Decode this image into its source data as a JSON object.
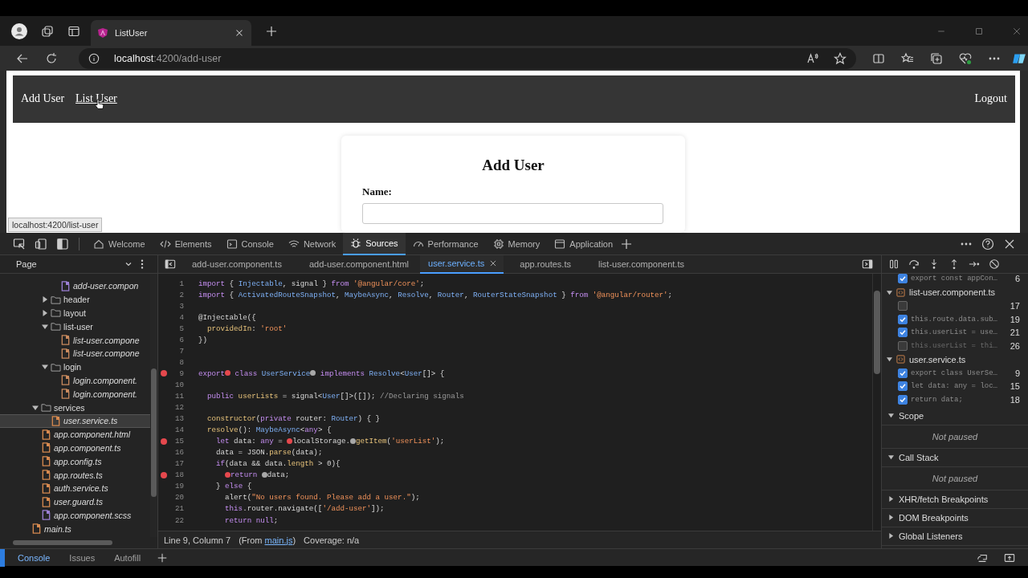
{
  "browser": {
    "tab": {
      "title": "ListUser"
    },
    "address": {
      "host": "localhost",
      "path": ":4200/add-user"
    }
  },
  "page": {
    "nav": {
      "links": [
        {
          "label": "Add User",
          "hovered": false
        },
        {
          "label": "List User",
          "hovered": true
        }
      ],
      "logout": "Logout"
    },
    "card": {
      "title": "Add User",
      "field_label": "Name:"
    },
    "status_url": "localhost:4200/list-user"
  },
  "devtools": {
    "tabs": [
      {
        "label": "Welcome",
        "selected": false
      },
      {
        "label": "Elements",
        "selected": false
      },
      {
        "label": "Console",
        "selected": false
      },
      {
        "label": "Network",
        "selected": false
      },
      {
        "label": "Sources",
        "selected": true
      },
      {
        "label": "Performance",
        "selected": false
      },
      {
        "label": "Memory",
        "selected": false
      },
      {
        "label": "Application",
        "selected": false
      }
    ],
    "sidebar": {
      "header": "Page",
      "tree": [
        {
          "children": [
            {
              "children": [
                {
                  "children": [
                    {
                      "name": "add-user.compon",
                      "kind": "file",
                      "selected": false,
                      "color": "#9b7fd4"
                    }
                  ]
                },
                {
                  "name": "header",
                  "kind": "folder",
                  "expanded": false
                },
                {
                  "name": "layout",
                  "kind": "folder",
                  "expanded": false
                },
                {
                  "name": "list-user",
                  "kind": "folder",
                  "expanded": true,
                  "children": [
                    {
                      "name": "list-user.compone",
                      "kind": "file",
                      "selected": false,
                      "color": "#c98a5e"
                    },
                    {
                      "name": "list-user.compone",
                      "kind": "file",
                      "selected": false,
                      "color": "#c98a5e"
                    }
                  ]
                },
                {
                  "name": "login",
                  "kind": "folder",
                  "expanded": true,
                  "children": [
                    {
                      "name": "login.component.",
                      "kind": "file",
                      "selected": false,
                      "color": "#c98a5e"
                    },
                    {
                      "name": "login.component.",
                      "kind": "file",
                      "selected": false,
                      "color": "#c98a5e"
                    }
                  ]
                }
              ]
            },
            {
              "name": "services",
              "kind": "folder",
              "expanded": true,
              "children": [
                {
                  "name": "user.service.ts",
                  "kind": "file",
                  "selected": true,
                  "color": "#d6894f"
                }
              ]
            },
            {
              "name": "app.component.html",
              "kind": "file",
              "selected": false,
              "color": "#d6894f"
            },
            {
              "name": "app.component.ts",
              "kind": "file",
              "selected": false,
              "color": "#d6894f"
            },
            {
              "name": "app.config.ts",
              "kind": "file",
              "selected": false,
              "color": "#d6894f"
            },
            {
              "name": "app.routes.ts",
              "kind": "file",
              "selected": false,
              "color": "#d6894f"
            },
            {
              "name": "auth.service.ts",
              "kind": "file",
              "selected": false,
              "color": "#d6894f"
            },
            {
              "name": "user.guard.ts",
              "kind": "file",
              "selected": false,
              "color": "#d6894f"
            },
            {
              "name": "app.component.scss",
              "kind": "file",
              "selected": false,
              "color": "#9b7fd4"
            }
          ]
        },
        {
          "name": "main.ts",
          "kind": "file",
          "selected": false,
          "color": "#d6894f"
        }
      ]
    },
    "files": [
      {
        "name": "add-user.component.ts",
        "selected": false
      },
      {
        "name": "add-user.component.html",
        "selected": false
      },
      {
        "name": "user.service.ts",
        "selected": true
      },
      {
        "name": "app.routes.ts",
        "selected": false
      },
      {
        "name": "list-user.component.ts",
        "selected": false
      }
    ],
    "lines": [
      {
        "number": "1",
        "breakpoint": false,
        "tokens": [
          {
            "kind": "keyword",
            "text": "import"
          },
          {
            "kind": "plain",
            "text": " { "
          },
          {
            "kind": "type",
            "text": "Injectable"
          },
          {
            "kind": "plain",
            "text": ", signal } "
          },
          {
            "kind": "keyword",
            "text": "from"
          },
          {
            "kind": "string",
            "text": " '@angular/core'"
          },
          {
            "kind": "plain",
            "text": ";"
          }
        ]
      },
      {
        "number": "2",
        "breakpoint": false,
        "tokens": [
          {
            "kind": "keyword",
            "text": "import"
          },
          {
            "kind": "plain",
            "text": " { "
          },
          {
            "kind": "type",
            "text": "ActivatedRouteSnapshot"
          },
          {
            "kind": "plain",
            "text": ", "
          },
          {
            "kind": "type",
            "text": "MaybeAsync"
          },
          {
            "kind": "plain",
            "text": ", "
          },
          {
            "kind": "type",
            "text": "Resolve"
          },
          {
            "kind": "plain",
            "text": ", "
          },
          {
            "kind": "type",
            "text": "Router"
          },
          {
            "kind": "plain",
            "text": ", "
          },
          {
            "kind": "type",
            "text": "RouterStateSnapshot"
          },
          {
            "kind": "plain",
            "text": " } "
          },
          {
            "kind": "keyword",
            "text": "from"
          },
          {
            "kind": "string",
            "text": " '@angular/router'"
          },
          {
            "kind": "plain",
            "text": ";"
          }
        ]
      },
      {
        "number": "3",
        "breakpoint": false
      },
      {
        "number": "4",
        "breakpoint": false,
        "tokens": [
          {
            "kind": "plain",
            "text": "@Injectable({"
          }
        ]
      },
      {
        "number": "5",
        "breakpoint": false,
        "tokens": [
          {
            "kind": "function",
            "text": "  providedIn"
          },
          {
            "kind": "plain",
            "text": ": "
          },
          {
            "kind": "string",
            "text": "'root'"
          }
        ]
      },
      {
        "number": "6",
        "breakpoint": false,
        "tokens": [
          {
            "kind": "plain",
            "text": "})"
          }
        ]
      },
      {
        "number": "7",
        "breakpoint": false
      },
      {
        "number": "8",
        "breakpoint": false
      },
      {
        "number": "9",
        "breakpoint": true,
        "tokens": [
          {
            "kind": "keyword",
            "text": "export",
            "dot_after": {
              "active": true
            }
          },
          {
            "kind": "keyword",
            "text": " class "
          },
          {
            "kind": "type",
            "text": "UserService",
            "dot_after": {
              "active": false
            }
          },
          {
            "kind": "keyword",
            "text": " implements "
          },
          {
            "kind": "type",
            "text": "Resolve"
          },
          {
            "kind": "plain",
            "text": "<"
          },
          {
            "kind": "type",
            "text": "User"
          },
          {
            "kind": "plain",
            "text": "[]> {"
          }
        ]
      },
      {
        "number": "10",
        "breakpoint": false
      },
      {
        "number": "11",
        "breakpoint": false,
        "tokens": [
          {
            "kind": "keyword",
            "text": "  public"
          },
          {
            "kind": "function",
            "text": " userLists"
          },
          {
            "kind": "plain",
            "text": " = signal<"
          },
          {
            "kind": "type",
            "text": "User"
          },
          {
            "kind": "plain",
            "text": "[]>([]); "
          },
          {
            "kind": "comment",
            "text": "//Declaring signals"
          }
        ]
      },
      {
        "number": "12",
        "breakpoint": false
      },
      {
        "number": "13",
        "breakpoint": false,
        "tokens": [
          {
            "kind": "function",
            "text": "  constructor"
          },
          {
            "kind": "plain",
            "text": "("
          },
          {
            "kind": "keyword",
            "text": "private"
          },
          {
            "kind": "plain",
            "text": " router: "
          },
          {
            "kind": "type",
            "text": "Router"
          },
          {
            "kind": "plain",
            "text": ") { }"
          }
        ]
      },
      {
        "number": "14",
        "breakpoint": false,
        "tokens": [
          {
            "kind": "function",
            "text": "  resolve"
          },
          {
            "kind": "plain",
            "text": "(): "
          },
          {
            "kind": "type",
            "text": "MaybeAsync"
          },
          {
            "kind": "plain",
            "text": "<"
          },
          {
            "kind": "keyword",
            "text": "any"
          },
          {
            "kind": "plain",
            "text": "> {"
          }
        ]
      },
      {
        "number": "15",
        "breakpoint": true,
        "tokens": [
          {
            "kind": "keyword",
            "text": "    let"
          },
          {
            "kind": "plain",
            "text": " data: "
          },
          {
            "kind": "keyword",
            "text": "any"
          },
          {
            "kind": "plain",
            "text": " = "
          },
          {
            "kind": "plain",
            "text": "localStorage.",
            "dot_before": {
              "active": true
            }
          },
          {
            "kind": "function",
            "text": "getItem",
            "dot_before": {
              "active": false
            }
          },
          {
            "kind": "plain",
            "text": "("
          },
          {
            "kind": "string",
            "text": "'userList'"
          },
          {
            "kind": "plain",
            "text": ");"
          }
        ]
      },
      {
        "number": "16",
        "breakpoint": false,
        "tokens": [
          {
            "kind": "plain",
            "text": "    data = JSON."
          },
          {
            "kind": "function",
            "text": "parse"
          },
          {
            "kind": "plain",
            "text": "(data);"
          }
        ]
      },
      {
        "number": "17",
        "breakpoint": false,
        "tokens": [
          {
            "kind": "keyword",
            "text": "    if"
          },
          {
            "kind": "plain",
            "text": "(data && data."
          },
          {
            "kind": "function",
            "text": "length"
          },
          {
            "kind": "plain",
            "text": " > 0){"
          }
        ]
      },
      {
        "number": "18",
        "breakpoint": true,
        "tokens": [
          {
            "kind": "keyword",
            "text": "      return",
            "dot_before": {
              "active": true
            }
          },
          {
            "kind": "plain",
            "text": " data;",
            "dot_before": {
              "active": false
            }
          }
        ]
      },
      {
        "number": "19",
        "breakpoint": false,
        "tokens": [
          {
            "kind": "plain",
            "text": "    } "
          },
          {
            "kind": "keyword",
            "text": "else"
          },
          {
            "kind": "plain",
            "text": " {"
          }
        ]
      },
      {
        "number": "20",
        "breakpoint": false,
        "tokens": [
          {
            "kind": "plain",
            "text": "      alert("
          },
          {
            "kind": "string",
            "text": "\"No users found. Please add a user.\""
          },
          {
            "kind": "plain",
            "text": ");"
          }
        ]
      },
      {
        "number": "21",
        "breakpoint": false,
        "tokens": [
          {
            "kind": "keyword",
            "text": "      this"
          },
          {
            "kind": "plain",
            "text": ".router.navigate(["
          },
          {
            "kind": "string",
            "text": "'/add-user'"
          },
          {
            "kind": "plain",
            "text": "]);"
          }
        ]
      },
      {
        "number": "22",
        "breakpoint": false,
        "tokens": [
          {
            "kind": "keyword",
            "text": "      return null"
          },
          {
            "kind": "plain",
            "text": ";"
          }
        ]
      }
    ],
    "status": {
      "position": "Line 9, Column 7",
      "source_prefix": "(From ",
      "source_link": "main.js",
      "source_suffix": ")",
      "coverage": "Coverage: n/a"
    },
    "breakpoints": [
      {
        "items": [
          {
            "code": "export const appCon…",
            "line": "6",
            "checked": true
          }
        ]
      },
      {
        "file": "list-user.component.ts",
        "expanded": true,
        "items": [
          {
            "line": "17",
            "checked": false
          },
          {
            "code": "this.route.data.sub…",
            "line": "19",
            "checked": true
          },
          {
            "code": "this.userList = use…",
            "line": "21",
            "checked": true
          },
          {
            "code": "this.userList = thi…",
            "line": "26",
            "checked": false
          }
        ]
      },
      {
        "file": "user.service.ts",
        "expanded": true,
        "items": [
          {
            "code": "export class UserSe…",
            "line": "9",
            "checked": true
          },
          {
            "code": "let data: any = loc…",
            "line": "15",
            "checked": true
          },
          {
            "code": "return data;",
            "line": "18",
            "checked": true
          }
        ]
      }
    ],
    "sections": [
      {
        "title": "Scope",
        "expanded": true,
        "message": "Not paused"
      },
      {
        "title": "Call Stack",
        "expanded": true,
        "message": "Not paused"
      },
      {
        "title": "XHR/fetch Breakpoints",
        "expanded": false
      },
      {
        "title": "DOM Breakpoints",
        "expanded": false
      },
      {
        "title": "Global Listeners",
        "expanded": false
      }
    ],
    "drawer_tabs": [
      {
        "label": "Console",
        "selected": true
      },
      {
        "label": "Issues",
        "selected": false
      },
      {
        "label": "Autofill",
        "selected": false
      }
    ]
  }
}
